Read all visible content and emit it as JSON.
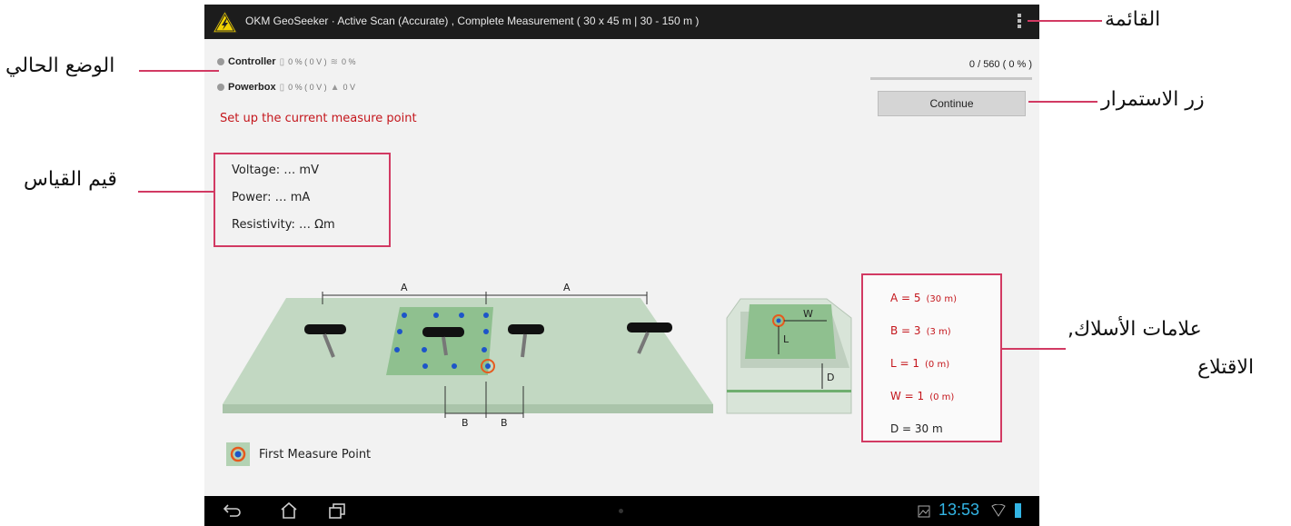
{
  "app": {
    "title": "OKM GeoSeeker  ·  Active Scan (Accurate) , Complete Measurement ( 30 x 45 m  |  30 - 150 m )"
  },
  "status": {
    "controller": {
      "label": "Controller",
      "battery": "0 % ( 0 V )",
      "signal": "0 %"
    },
    "powerbox": {
      "label": "Powerbox",
      "battery": "0 % ( 0 V )",
      "voltage": "0 V"
    }
  },
  "progress": {
    "text": "0 / 560 ( 0 % )",
    "fraction": 0
  },
  "continue_label": "Continue",
  "instruction": "Set up the current measure point",
  "values": {
    "voltage": "Voltage:  …  mV",
    "power": "Power:  …  mA",
    "resistivity": "Resistivity:  …  Ωm"
  },
  "diagram": {
    "label_a": "A",
    "label_b": "B",
    "label_w": "W",
    "label_l": "L",
    "label_d": "D"
  },
  "params": [
    {
      "name": "A = 5",
      "detail": "(30 m)",
      "color": "#c4161c"
    },
    {
      "name": "B = 3",
      "detail": "(3 m)",
      "color": "#c4161c"
    },
    {
      "name": "L = 1",
      "detail": "(0 m)",
      "color": "#c4161c"
    },
    {
      "name": "W = 1",
      "detail": "(0 m)",
      "color": "#c4161c"
    },
    {
      "name": "D = 30 m",
      "detail": "",
      "color": "#222222"
    }
  ],
  "first_point_label": "First Measure Point",
  "clock": "13:53",
  "callouts": {
    "menu": "القائمة",
    "status": "الوضع الحالي",
    "continue": "زر الاستمرار",
    "values": "قيم القياس",
    "markers_line1": "علامات الأسلاك,",
    "markers_line2": "الاقتلاع"
  },
  "colors": {
    "accent": "#33b5e5",
    "annotation": "#d23a63",
    "alert": "#c4161c"
  }
}
